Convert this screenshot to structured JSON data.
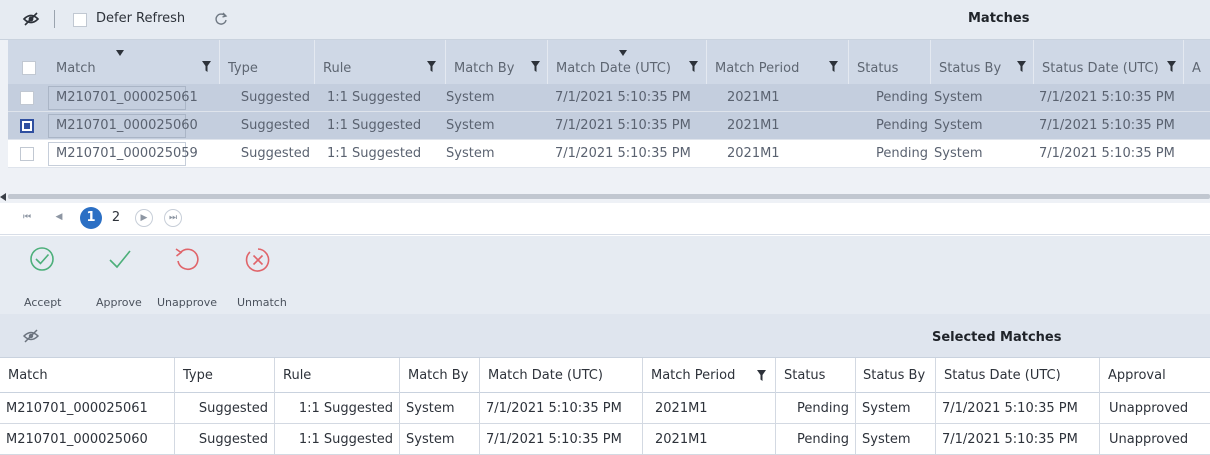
{
  "toolbar": {
    "defer_refresh_label": "Defer Refresh",
    "title": "Matches"
  },
  "icons": {
    "off": "eye-off-icon",
    "refresh": "refresh-icon",
    "filter": "filter-icon",
    "sort": "sort-desc-icon"
  },
  "matches_grid": {
    "columns": [
      "Match",
      "Type",
      "Rule",
      "Match By",
      "Match Date (UTC)",
      "Match Period",
      "Status",
      "Status By",
      "Status Date (UTC)",
      "A"
    ],
    "rows": [
      {
        "match": "M210701_000025061",
        "type": "Suggested",
        "rule": "1:1 Suggested",
        "match_by": "System",
        "match_date": "7/1/2021 5:10:35 PM",
        "match_period": "2021M1",
        "status": "Pending",
        "status_by": "System",
        "status_date": "7/1/2021 5:10:35 PM",
        "checked": false,
        "selected": true
      },
      {
        "match": "M210701_000025060",
        "type": "Suggested",
        "rule": "1:1 Suggested",
        "match_by": "System",
        "match_date": "7/1/2021 5:10:35 PM",
        "match_period": "2021M1",
        "status": "Pending",
        "status_by": "System",
        "status_date": "7/1/2021 5:10:35 PM",
        "checked": true,
        "selected": true
      },
      {
        "match": "M210701_000025059",
        "type": "Suggested",
        "rule": "1:1 Suggested",
        "match_by": "System",
        "match_date": "7/1/2021 5:10:35 PM",
        "match_period": "2021M1",
        "status": "Pending",
        "status_by": "System",
        "status_date": "7/1/2021 5:10:35 PM",
        "checked": false,
        "selected": false
      }
    ]
  },
  "pager": {
    "first": "⏮",
    "prev": "◀",
    "pages": [
      "1",
      "2"
    ],
    "current_page": "1",
    "next": "▶",
    "last": "⏭"
  },
  "actions": {
    "accept": "Accept",
    "approve": "Approve",
    "unapprove": "Unapprove",
    "unmatch": "Unmatch"
  },
  "selected_matches": {
    "title": "Selected Matches",
    "columns": [
      "Match",
      "Type",
      "Rule",
      "Match By",
      "Match Date (UTC)",
      "Match Period",
      "Status",
      "Status By",
      "Status Date (UTC)",
      "Approval"
    ],
    "rows": [
      {
        "match": "M210701_000025061",
        "type": "Suggested",
        "rule": "1:1 Suggested",
        "match_by": "System",
        "match_date": "7/1/2021 5:10:35 PM",
        "match_period": "2021M1",
        "status": "Pending",
        "status_by": "System",
        "status_date": "7/1/2021 5:10:35 PM",
        "approval": "Unapproved"
      },
      {
        "match": "M210701_000025060",
        "type": "Suggested",
        "rule": "1:1 Suggested",
        "match_by": "System",
        "match_date": "7/1/2021 5:10:35 PM",
        "match_period": "2021M1",
        "status": "Pending",
        "status_by": "System",
        "status_date": "7/1/2021 5:10:35 PM",
        "approval": "Unapproved"
      }
    ]
  },
  "colors": {
    "accent": "#2b6fc4",
    "toolbar_bg": "#e6ebf2",
    "header_bg": "#cfd8e6",
    "selected_row_bg": "#c4cede",
    "accept_icon": "#4caf7a",
    "approve_icon": "#4caf7a",
    "unapprove_icon": "#e0646a",
    "unmatch_icon": "#e0646a"
  }
}
